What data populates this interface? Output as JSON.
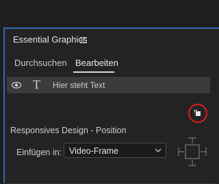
{
  "panel": {
    "title": "Essential Graphics",
    "menu_icon": "hamburger-icon"
  },
  "tabs": [
    {
      "label": "Durchsuchen",
      "active": false
    },
    {
      "label": "Bearbeiten",
      "active": true
    }
  ],
  "layers": [
    {
      "visibility_icon": "eye-icon",
      "type_icon": "text-layer-icon",
      "name": "Hier steht Text"
    }
  ],
  "toolbar": {
    "new_layer_icon": "new-layer-icon"
  },
  "responsive": {
    "section_title": "Responsives Design - Position",
    "pin_label": "Einfügen in:",
    "pin_value": "Video-Frame",
    "pin_diagram_icon": "pin-edges-icon"
  },
  "colors": {
    "accent": "#2f6eb8",
    "highlight_circle": "#e01b1b"
  }
}
